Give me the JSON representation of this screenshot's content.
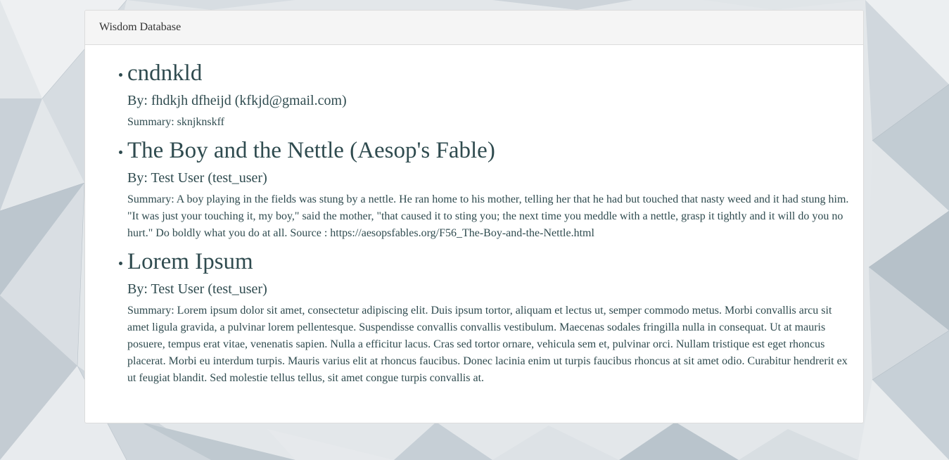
{
  "app": {
    "title": "Wisdom Database"
  },
  "colors": {
    "text": "#2f4b4f",
    "panel_bg": "#ffffff",
    "heading_bg": "#f5f5f5"
  },
  "entries": [
    {
      "title": "cndnkld",
      "author": "By: fhdkjh dfheijd (kfkjd@gmail.com)",
      "summary": "Summary: sknjknskff"
    },
    {
      "title": "The Boy and the Nettle (Aesop's Fable)",
      "author": "By: Test User (test_user)",
      "summary": "Summary: A boy playing in the fields was stung by a nettle. He ran home to his mother, telling her that he had but touched that nasty weed and it had stung him. \"It was just your touching it, my boy,\" said the mother, \"that caused it to sting you; the next time you meddle with a nettle, grasp it tightly and it will do you no hurt.\" Do boldly what you do at all. Source : https://aesopsfables.org/F56_The-Boy-and-the-Nettle.html"
    },
    {
      "title": "Lorem Ipsum",
      "author": "By: Test User (test_user)",
      "summary": "Summary: Lorem ipsum dolor sit amet, consectetur adipiscing elit. Duis ipsum tortor, aliquam et lectus ut, semper commodo metus. Morbi convallis arcu sit amet ligula gravida, a pulvinar lorem pellentesque. Suspendisse convallis convallis vestibulum. Maecenas sodales fringilla nulla in consequat. Ut at mauris posuere, tempus erat vitae, venenatis sapien. Nulla a efficitur lacus. Cras sed tortor ornare, vehicula sem et, pulvinar orci. Nullam tristique est eget rhoncus placerat. Morbi eu interdum turpis. Mauris varius elit at rhoncus faucibus. Donec lacinia enim ut turpis faucibus rhoncus at sit amet odio. Curabitur hendrerit ex ut feugiat blandit. Sed molestie tellus tellus, sit amet congue turpis convallis at."
    }
  ]
}
